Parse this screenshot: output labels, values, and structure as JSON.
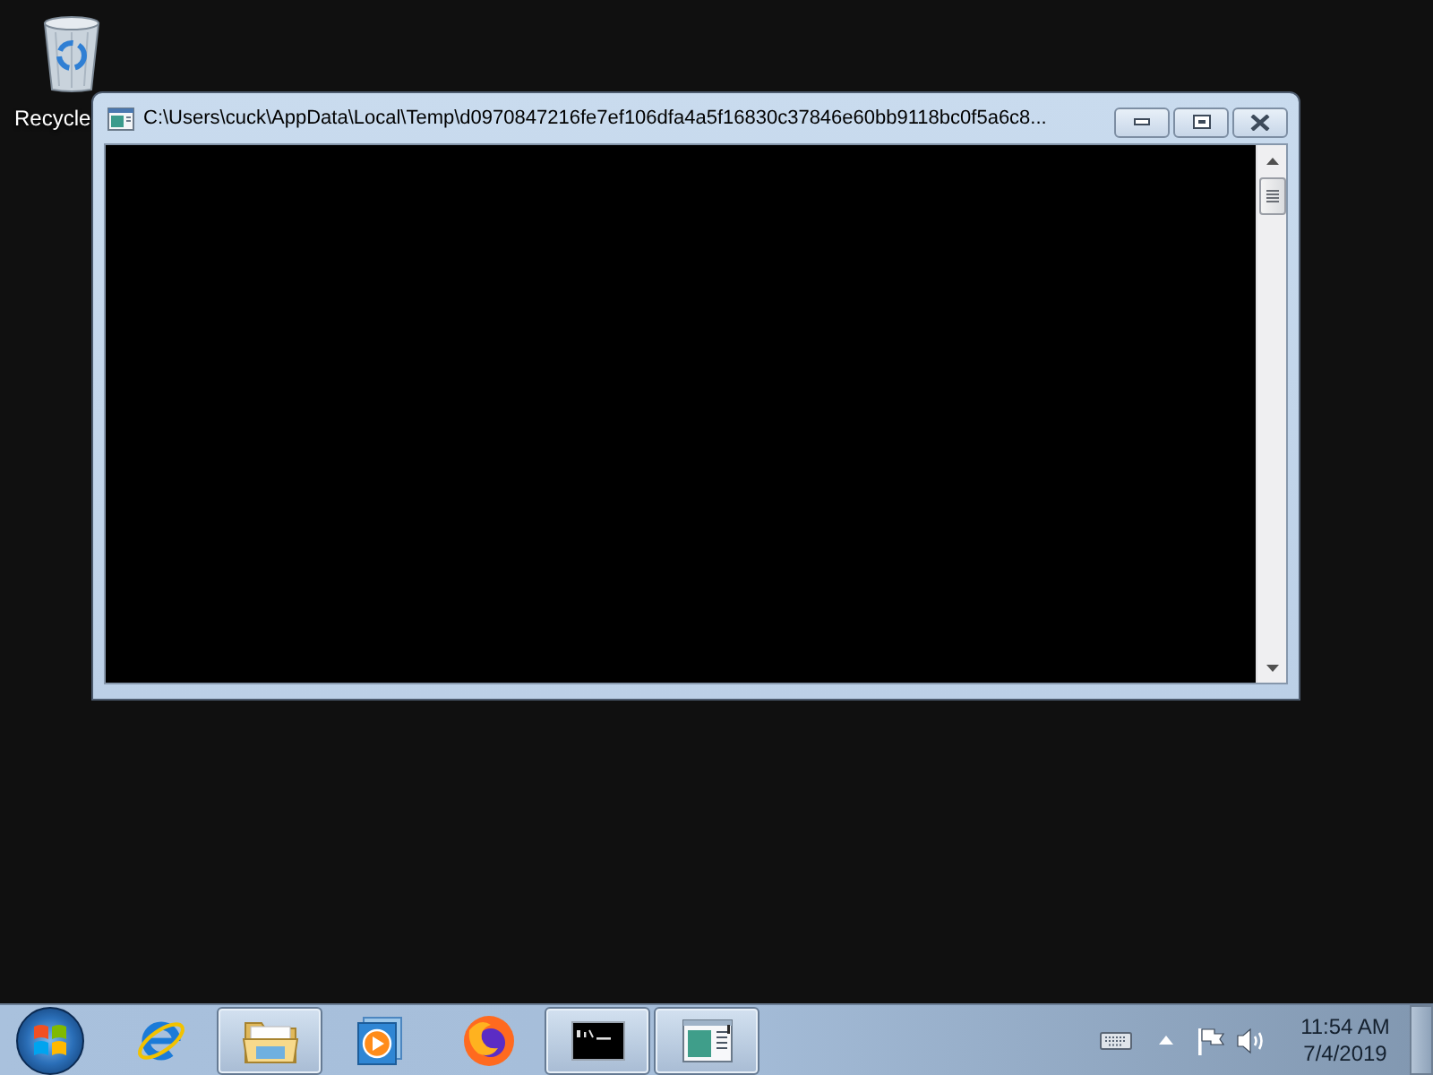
{
  "desktop": {
    "icons": [
      {
        "label": "Recycle"
      }
    ]
  },
  "window": {
    "title": "C:\\Users\\cuck\\AppData\\Local\\Temp\\d0970847216fe7ef106dfa4a5f16830c37846e60bb9118bc0f5a6c8..."
  },
  "taskbar": {
    "items": [
      {
        "kind": "browser",
        "running": false
      },
      {
        "kind": "folder",
        "running": true
      },
      {
        "kind": "media",
        "running": false
      },
      {
        "kind": "firefox",
        "running": false
      },
      {
        "kind": "console",
        "running": true
      },
      {
        "kind": "document",
        "running": true
      }
    ],
    "clock": {
      "time": "11:54 AM",
      "date": "7/4/2019"
    }
  }
}
